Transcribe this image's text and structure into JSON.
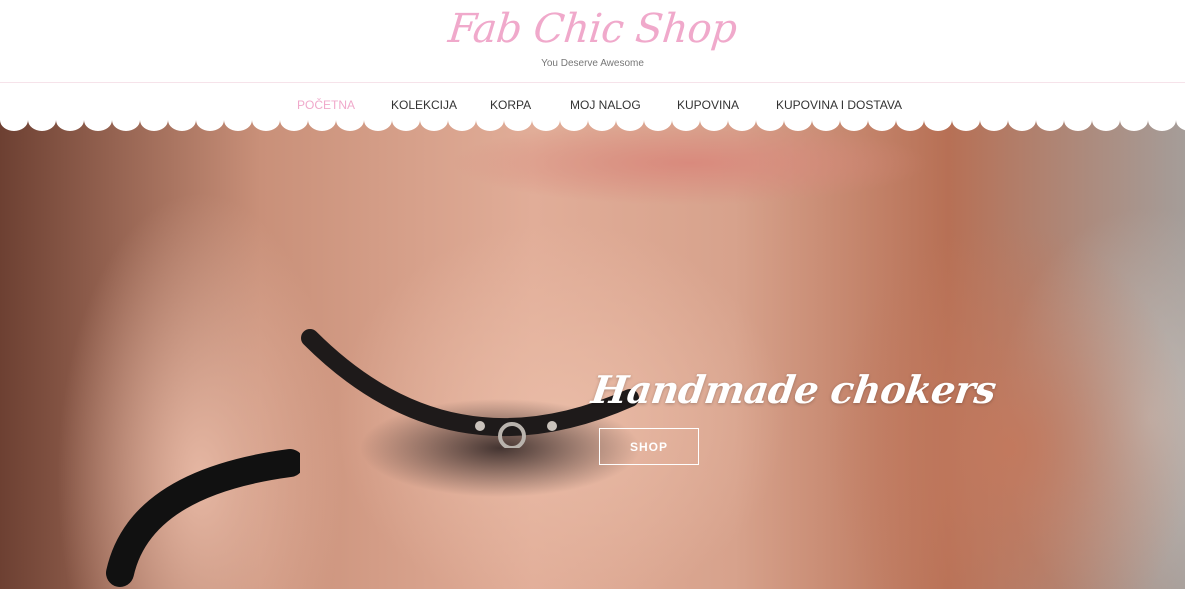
{
  "site": {
    "title": "Fab Chic Shop",
    "tagline": "You Deserve Awesome"
  },
  "nav": {
    "items": [
      {
        "label": "POČETNA",
        "active": true
      },
      {
        "label": "KOLEKCIJA",
        "active": false
      },
      {
        "label": "KORPA",
        "active": false
      },
      {
        "label": "MOJ NALOG",
        "active": false
      },
      {
        "label": "KUPOVINA",
        "active": false
      },
      {
        "label": "KUPOVINA I DOSTAVA",
        "active": false
      }
    ]
  },
  "hero": {
    "heading": "Handmade chokers",
    "button_label": "SHOP"
  },
  "colors": {
    "brand_pink": "#f0a9cb",
    "nav_text": "#333333",
    "tagline_text": "#777777",
    "hero_text": "#ffffff"
  }
}
